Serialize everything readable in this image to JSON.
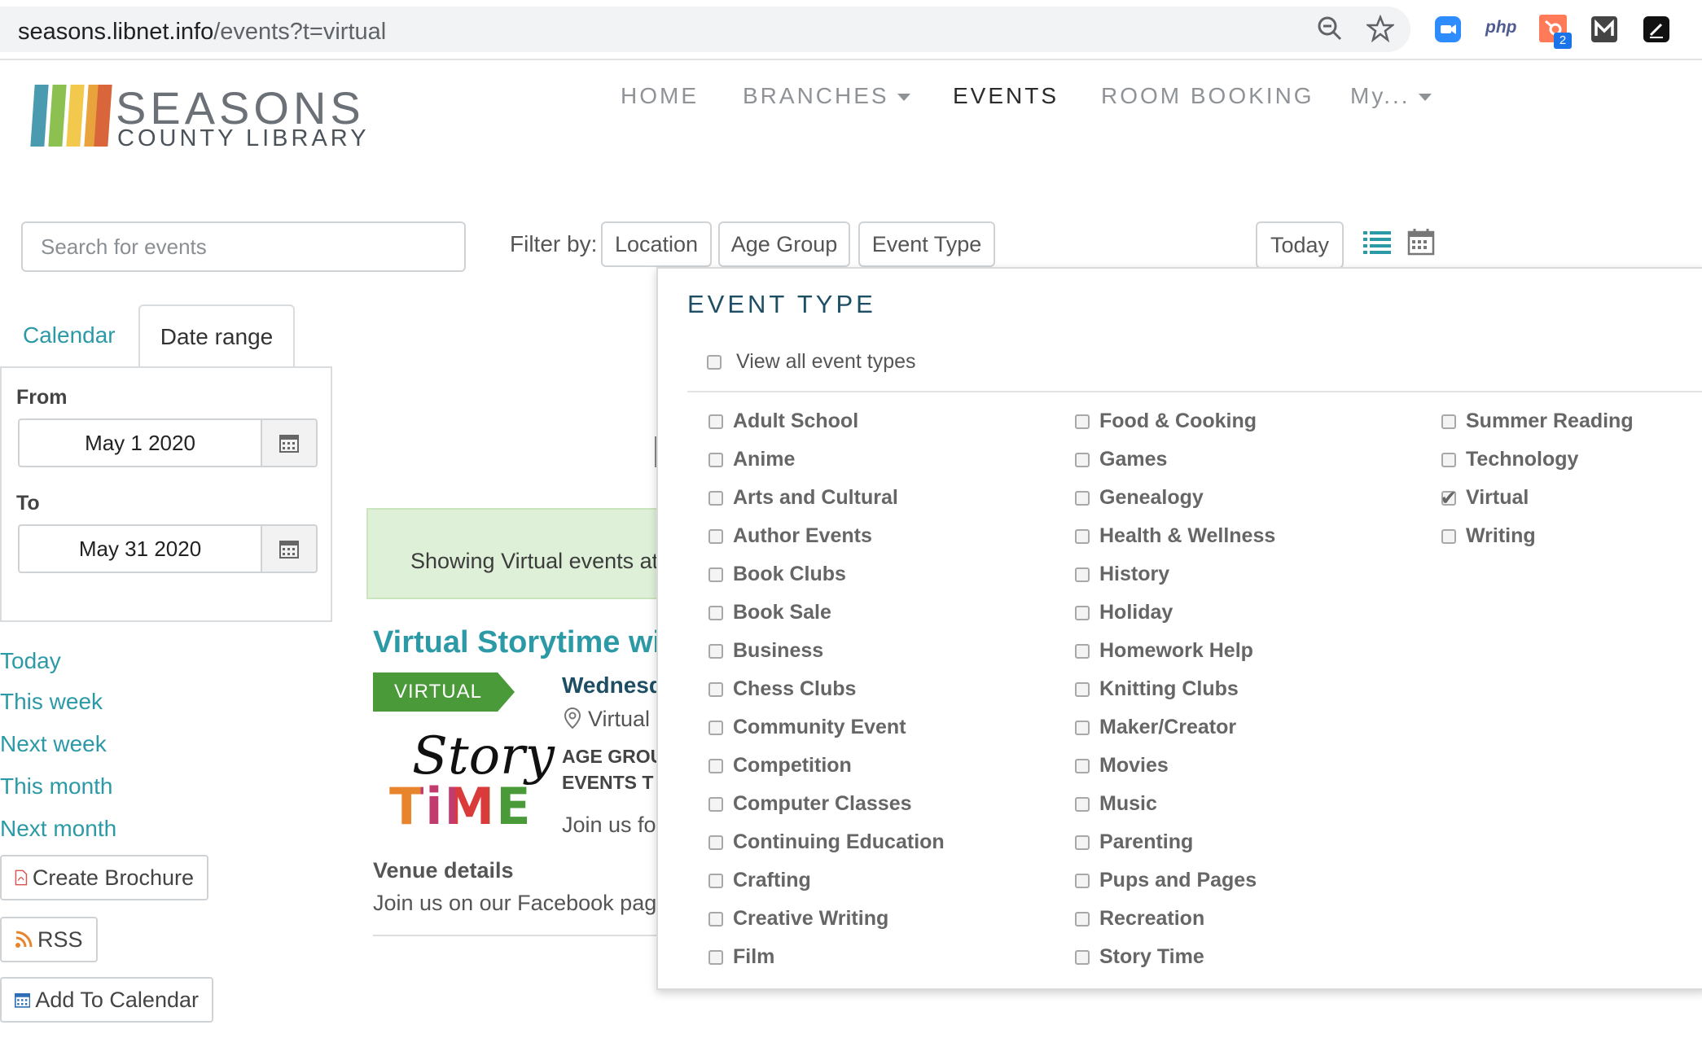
{
  "browser": {
    "url_host": "seasons.libnet.info",
    "url_path": "/events?t=virtual",
    "extensions": [
      {
        "name": "zoom-extension-icon",
        "color": "#2d8cff"
      },
      {
        "name": "php-extension-icon",
        "label": "php"
      },
      {
        "name": "hubspot-extension-icon",
        "badge": "2",
        "color": "#ff7a59"
      },
      {
        "name": "mailtrack-extension-icon"
      },
      {
        "name": "pen-extension-icon"
      }
    ]
  },
  "logo": {
    "title": "SEASONS",
    "subtitle": "COUNTY LIBRARY",
    "bar_colors": [
      "#4a9bb0",
      "#8cc152",
      "#f2c94c",
      "#e8a33d",
      "#d9663b"
    ]
  },
  "nav": {
    "home": "HOME",
    "branches": "BRANCHES",
    "events": "EVENTS",
    "room_booking": "ROOM BOOKING",
    "my": "My..."
  },
  "filters": {
    "search_placeholder": "Search for events",
    "filter_by": "Filter by:",
    "location": "Location",
    "age_group": "Age Group",
    "event_type": "Event Type",
    "today": "Today"
  },
  "tabs": {
    "calendar": "Calendar",
    "date_range": "Date range"
  },
  "date_range": {
    "from_label": "From",
    "from_value": "May 1 2020",
    "to_label": "To",
    "to_value": "May 31 2020"
  },
  "quick_links": [
    "Today",
    "This week",
    "Next week",
    "This month",
    "Next month"
  ],
  "sidebar_buttons": {
    "brochure": "Create Brochure",
    "rss": "RSS",
    "add_calendar": "Add To Calendar"
  },
  "notice": "Showing Virtual events at",
  "event": {
    "title": "Virtual Storytime wi",
    "badge": "VIRTUAL",
    "date": "Wednesd",
    "location": "Virtual",
    "age_group_label": "AGE GROU",
    "event_types_label": "EVENTS T",
    "description": "Join us fo",
    "image_text_top": "Story",
    "image_text_bottom": "TiME",
    "venue_title": "Venue details",
    "venue_text": "Join us on our Facebook pag"
  },
  "dropdown": {
    "title": "EVENT TYPE",
    "view_all": "View all event types",
    "columns": [
      [
        {
          "label": "Adult School",
          "checked": false
        },
        {
          "label": "Anime",
          "checked": false
        },
        {
          "label": "Arts and Cultural",
          "checked": false
        },
        {
          "label": "Author Events",
          "checked": false
        },
        {
          "label": "Book Clubs",
          "checked": false
        },
        {
          "label": "Book Sale",
          "checked": false
        },
        {
          "label": "Business",
          "checked": false
        },
        {
          "label": "Chess Clubs",
          "checked": false
        },
        {
          "label": "Community Event",
          "checked": false
        },
        {
          "label": "Competition",
          "checked": false
        },
        {
          "label": "Computer Classes",
          "checked": false
        },
        {
          "label": "Continuing Education",
          "checked": false
        },
        {
          "label": "Crafting",
          "checked": false
        },
        {
          "label": "Creative Writing",
          "checked": false
        },
        {
          "label": "Film",
          "checked": false
        }
      ],
      [
        {
          "label": "Food & Cooking",
          "checked": false
        },
        {
          "label": "Games",
          "checked": false
        },
        {
          "label": "Genealogy",
          "checked": false
        },
        {
          "label": "Health & Wellness",
          "checked": false
        },
        {
          "label": "History",
          "checked": false
        },
        {
          "label": "Holiday",
          "checked": false
        },
        {
          "label": "Homework Help",
          "checked": false
        },
        {
          "label": "Knitting Clubs",
          "checked": false
        },
        {
          "label": "Maker/Creator",
          "checked": false
        },
        {
          "label": "Movies",
          "checked": false
        },
        {
          "label": "Music",
          "checked": false
        },
        {
          "label": "Parenting",
          "checked": false
        },
        {
          "label": "Pups and Pages",
          "checked": false
        },
        {
          "label": "Recreation",
          "checked": false
        },
        {
          "label": "Story Time",
          "checked": false
        }
      ],
      [
        {
          "label": "Summer Reading",
          "checked": false
        },
        {
          "label": "Technology",
          "checked": false
        },
        {
          "label": "Virtual",
          "checked": true
        },
        {
          "label": "Writing",
          "checked": false
        }
      ]
    ]
  },
  "colors": {
    "accent": "#2c9aa6",
    "heading": "#1d4e63",
    "badge": "#4b9a3a",
    "notice_bg": "#dff0d8"
  }
}
